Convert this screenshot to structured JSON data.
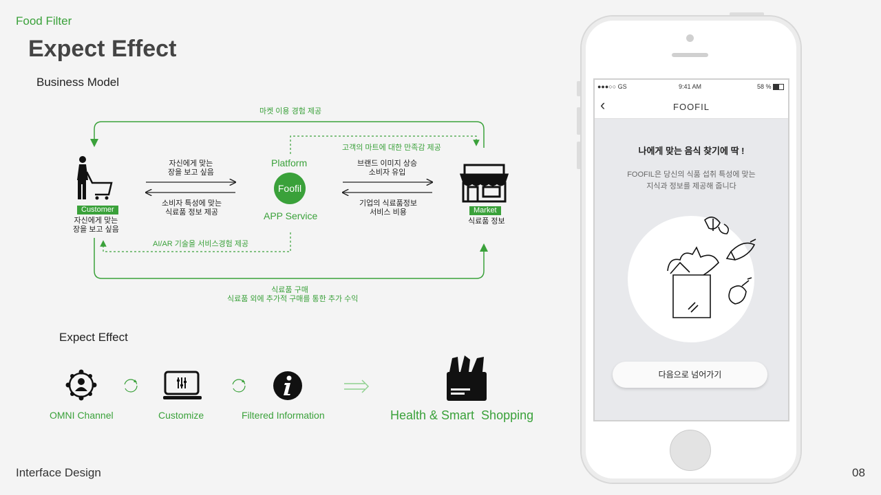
{
  "header": {
    "brand": "Food Filter",
    "title": "Expect Effect"
  },
  "business_model": {
    "heading": "Business Model",
    "top_arrow_label": "마켓 이용 경험 제공",
    "dashed_top_label": "고객의 마트에 대한 만족감 제공",
    "customer_to_platform": [
      "자신에게 맞는",
      "장을 보고 싶음"
    ],
    "platform_to_customer": [
      "소비자 특성에 맞는",
      "식료품 정보 제공"
    ],
    "platform_to_market": [
      "브랜드 이미지 상승",
      "소비자 유입"
    ],
    "market_to_platform": [
      "기업의 식료품정보",
      "서비스 비용"
    ],
    "platform_title": "Platform",
    "platform_badge": "Foofil",
    "platform_service": "APP Service",
    "customer_tag": "Customer",
    "customer_desc": [
      "자신에게 맞는",
      "장을 보고 싶음"
    ],
    "market_tag": "Market",
    "market_desc": "식료품 정보",
    "dashed_bottom_label": "AI/AR 기술을 서비스경험 제공",
    "bottom_arrow_label": [
      "식료품 구매",
      "식료품 외에 추가적 구매를 통한 추가 수익"
    ]
  },
  "expect_effect": {
    "heading": "Expect Effect",
    "items": [
      "OMNI Channel",
      "Customize",
      "Filtered Information"
    ],
    "result": "Health & Smart  Shopping"
  },
  "footer": {
    "left": "Interface Design",
    "page": "08"
  },
  "phone": {
    "status_left": "●●●○○ GS",
    "status_time": "9:41 AM",
    "status_battery": "58 %",
    "nav_back": "‹",
    "nav_title": "FOOFIL",
    "headline": "나에게 맞는 음식 찾기에 딱 !",
    "desc": [
      "FOOFIL은 당신의 식품 섭취 특성에 맞는",
      "지식과 정보를 제공해 줍니다"
    ],
    "cta": "다음으로 넘어가기"
  },
  "colors": {
    "accent": "#3aa13a",
    "text": "#222222"
  }
}
